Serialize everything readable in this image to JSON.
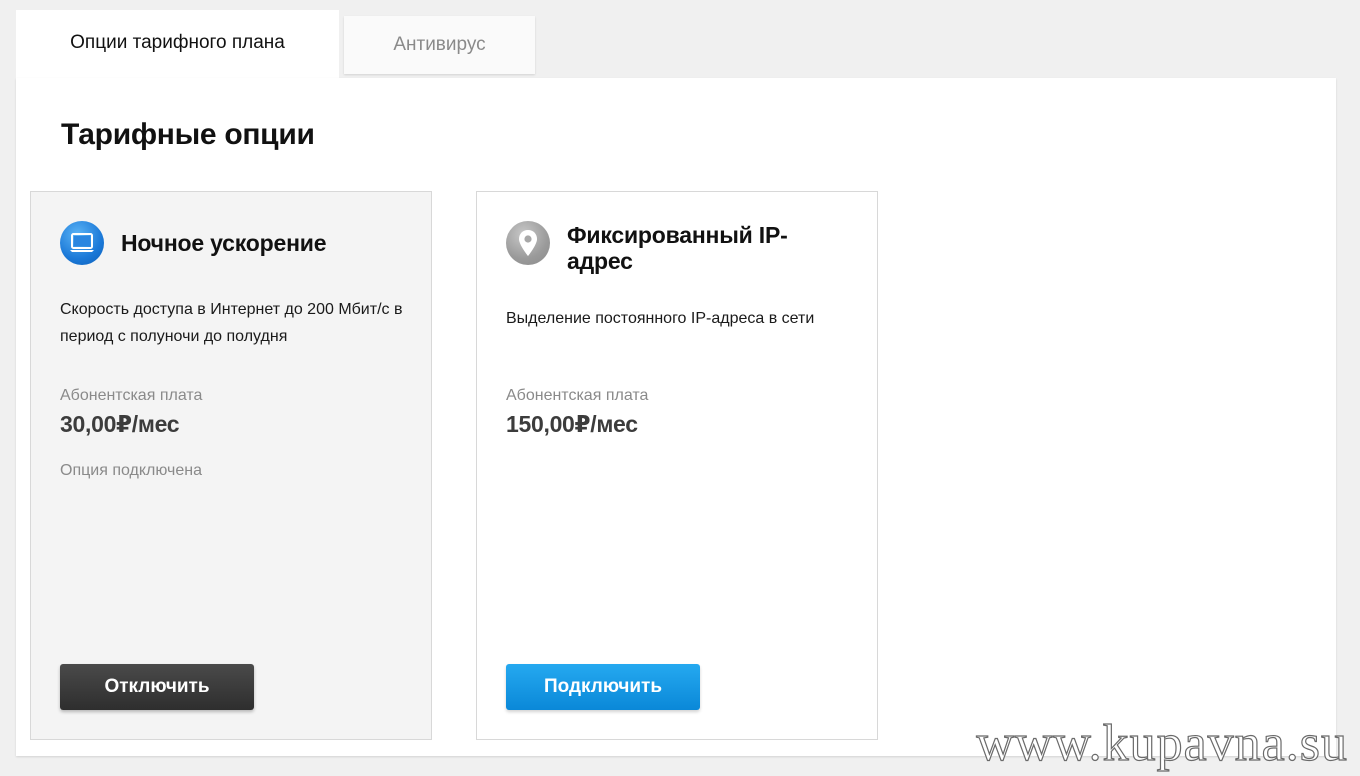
{
  "tabs": [
    {
      "label": "Опции тарифного плана",
      "active": true
    },
    {
      "label": "Антивирус",
      "active": false
    }
  ],
  "section": {
    "title": "Тарифные опции"
  },
  "cards": [
    {
      "icon": "monitor-icon",
      "title": "Ночное ускорение",
      "description": "Скорость доступа в Интернет до 200 Мбит/с в период с полуночи до полудня",
      "fee_label": "Абонентская плата",
      "fee_value": "30,00₽/мес",
      "status": "Опция подключена",
      "button_label": "Отключить"
    },
    {
      "icon": "location-pin-icon",
      "title": "Фиксированный IP-адрес",
      "description": "Выделение постоянного IP-адреса в сети",
      "fee_label": "Абонентская плата",
      "fee_value": "150,00₽/мес",
      "button_label": "Подключить"
    }
  ],
  "watermark": "www.kupavna.su",
  "colors": {
    "accent_blue": "#1a9be6",
    "dark_button": "#3a3a3a",
    "muted_text": "#8a8a8a",
    "card_bg_active": "#f4f4f4"
  }
}
